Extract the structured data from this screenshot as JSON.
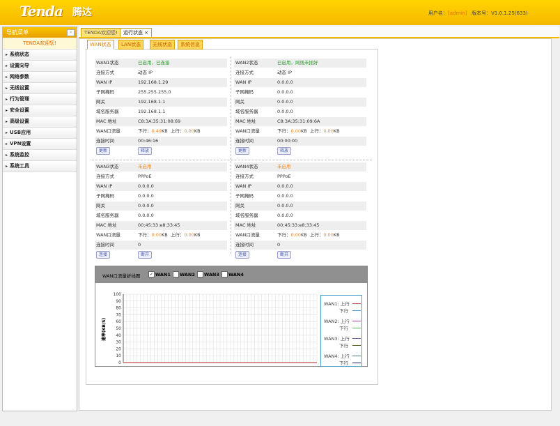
{
  "header": {
    "logo": "Tenda",
    "logo_cn": "腾达",
    "user_label": "用户名：",
    "user_value": "[admin]",
    "version_label": "版本号：",
    "version_value": "V1.0.1.25(633)"
  },
  "nav": {
    "title": "导航菜单",
    "collapse_icon": "«",
    "welcome": "TENDA欢迎您!",
    "items": [
      "系统状态",
      "设置向导",
      "网络参数",
      "无线设置",
      "行为管理",
      "安全设置",
      "高级设置",
      "USB应用",
      "VPN设置",
      "系统监控",
      "系统工具"
    ]
  },
  "tabs": {
    "welcome": "TENDA欢迎您!",
    "status": "运行状态",
    "close": "×"
  },
  "subtabs": [
    "WAN状态",
    "LAN状态",
    "无线状态",
    "系统信息"
  ],
  "labels": {
    "conn_type": "连接方式",
    "wan_ip": "WAN IP",
    "subnet": "子网掩码",
    "gateway": "网关",
    "dns": "域名服务器",
    "mac": "MAC 地址",
    "traffic": "WAN口流量",
    "uptime": "连接时间",
    "down": "下行：",
    "up": "上行：",
    "kb": "KB"
  },
  "wan": [
    {
      "title": "WAN1状态",
      "status": "已启用，已连接",
      "status_color": "green",
      "conn_type": "动态 IP",
      "wan_ip": "192.168.1.29",
      "subnet": "255.255.255.0",
      "gateway": "192.168.1.1",
      "dns": "192.168.1.1",
      "mac": "C8:3A:35:31:08:69",
      "down": "0.49",
      "up": "0.00",
      "uptime": "00:46:16",
      "btn1": "更新",
      "btn2": "释放"
    },
    {
      "title": "WAN2状态",
      "status": "已启用，网线未插好",
      "status_color": "green",
      "conn_type": "动态 IP",
      "wan_ip": "0.0.0.0",
      "subnet": "0.0.0.0",
      "gateway": "0.0.0.0",
      "dns": "0.0.0.0",
      "mac": "C8:3A:35:31:09:6A",
      "down": "0.00",
      "up": "0.00",
      "uptime": "00:00:00",
      "btn1": "更新",
      "btn2": "释放"
    },
    {
      "title": "WAN3状态",
      "status": "未启用",
      "status_color": "orange",
      "conn_type": "PPPoE",
      "wan_ip": "0.0.0.0",
      "subnet": "0.0.0.0",
      "gateway": "0.0.0.0",
      "dns": "0.0.0.0",
      "mac": "00:45:33:e8:33:45",
      "down": "0.00",
      "up": "0.00",
      "uptime": "0",
      "btn1": "连接",
      "btn2": "断开"
    },
    {
      "title": "WAN4状态",
      "status": "未启用",
      "status_color": "orange",
      "conn_type": "PPPoE",
      "wan_ip": "0.0.0.0",
      "subnet": "0.0.0.0",
      "gateway": "0.0.0.0",
      "dns": "0.0.0.0",
      "mac": "00:45:33:e8:33:45",
      "down": "0.00",
      "up": "0.00",
      "uptime": "0",
      "btn1": "连接",
      "btn2": "断开"
    }
  ],
  "chart_head": {
    "title": "WAN口流量折线图",
    "checkboxes": [
      {
        "label": "WAN1",
        "checked": true
      },
      {
        "label": "WAN2",
        "checked": false
      },
      {
        "label": "WAN3",
        "checked": false
      },
      {
        "label": "WAN4",
        "checked": false
      }
    ],
    "check_mark": "✓"
  },
  "chart_data": {
    "type": "line",
    "ylabel": "速率(KB/S)",
    "ylim": [
      0,
      100
    ],
    "yticks": [
      "100",
      "90",
      "80",
      "70",
      "60",
      "50",
      "40",
      "30",
      "20",
      "10",
      "0"
    ],
    "grid": true,
    "series": [
      {
        "name": "WAN1: 上行",
        "color": "#c0504d",
        "values": [
          0,
          0,
          0,
          0,
          0,
          0,
          0,
          0,
          0,
          0,
          0,
          0,
          0,
          0,
          0,
          0,
          0,
          0,
          0,
          0,
          0,
          0,
          0,
          0,
          0,
          0,
          0,
          0,
          0,
          0,
          0,
          0,
          0,
          0,
          0,
          0,
          0,
          0,
          0,
          0
        ]
      },
      {
        "name": "下行",
        "color": "#4aa0e0",
        "values": []
      },
      {
        "name": "WAN2: 上行",
        "color": "#b040b0",
        "values": []
      },
      {
        "name": "下行",
        "color": "#60c060",
        "values": []
      },
      {
        "name": "WAN3: 上行",
        "color": "#8060a0",
        "values": []
      },
      {
        "name": "下行",
        "color": "#606020",
        "values": []
      },
      {
        "name": "WAN4: 上行",
        "color": "#4a7a8a",
        "values": []
      },
      {
        "name": "下行",
        "color": "#202060",
        "values": []
      }
    ],
    "legend": "right"
  }
}
